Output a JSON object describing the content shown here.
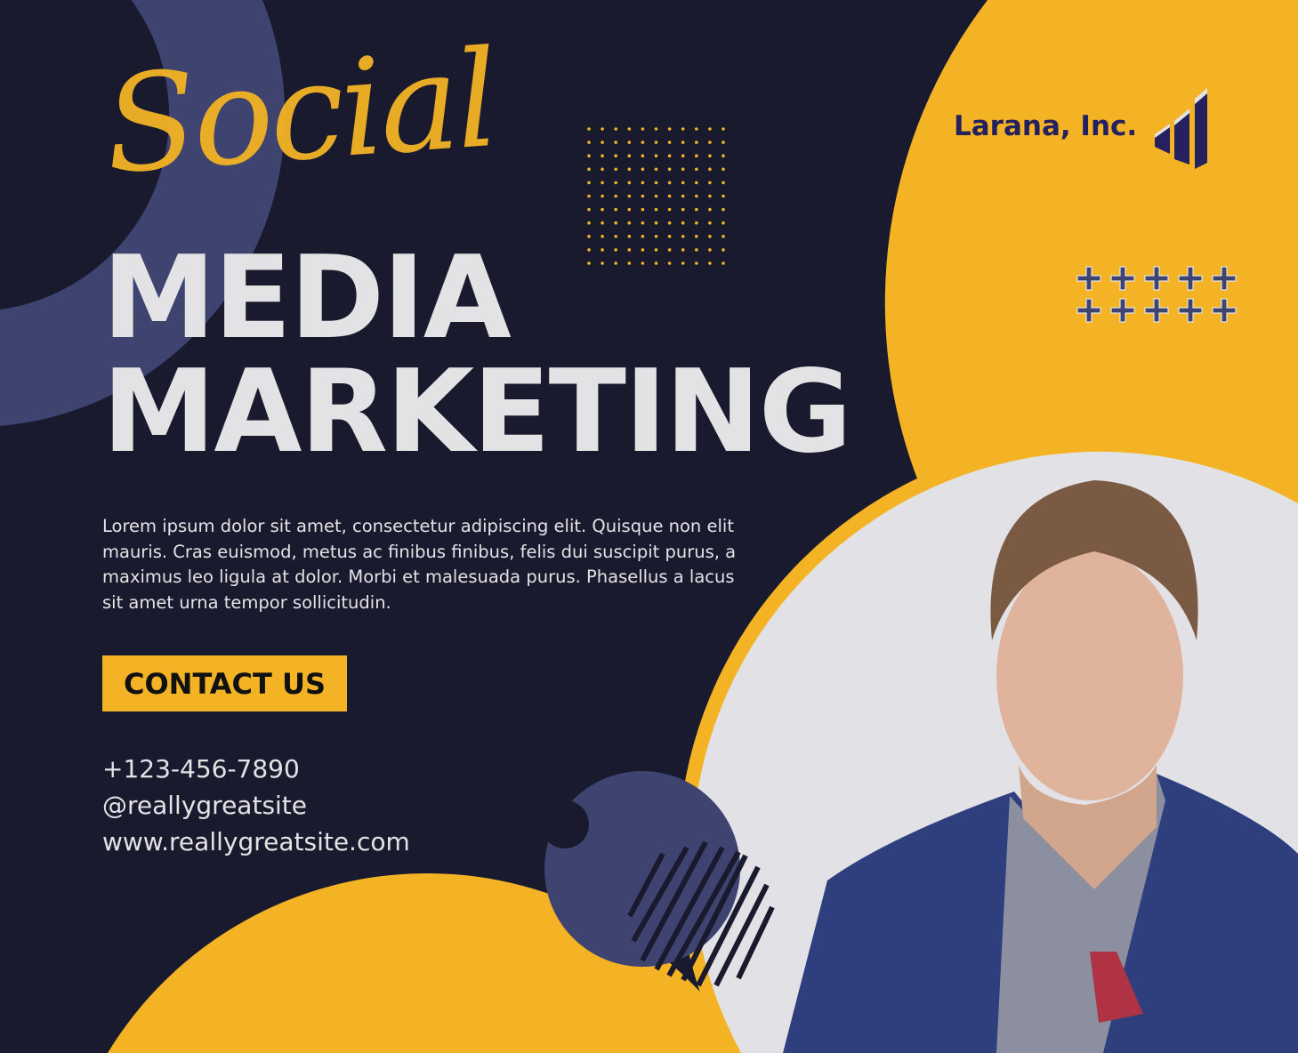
{
  "colors": {
    "background": "#1a1a2e",
    "accent_yellow": "#f3b325",
    "accent_purple": "#3e4370",
    "text": "#e3e3e6",
    "brand": "#24215e"
  },
  "headline": {
    "script": "Social",
    "line1": "MEDIA",
    "line2": "MARKETING"
  },
  "body_text": "Lorem ipsum dolor sit amet, consectetur adipiscing elit. Quisque non elit mauris. Cras euismod, metus ac finibus finibus, felis dui suscipit purus, a maximus leo ligula at dolor. Morbi et malesuada purus. Phasellus a lacus sit amet urna tempor sollicitudin.",
  "cta": {
    "label": "CONTACT US"
  },
  "contact_info": {
    "phone": "+123-456-7890",
    "handle": "@reallygreatsite",
    "website": "www.reallygreatsite.com"
  },
  "brand": {
    "name": "Larana, Inc.",
    "logo_icon": "bar-chart-icon"
  },
  "decorations": {
    "plus_icon": "plus-icon",
    "dot_grid": "dot-grid"
  },
  "photo": {
    "subject": "man-in-blue-blazer-portrait"
  }
}
